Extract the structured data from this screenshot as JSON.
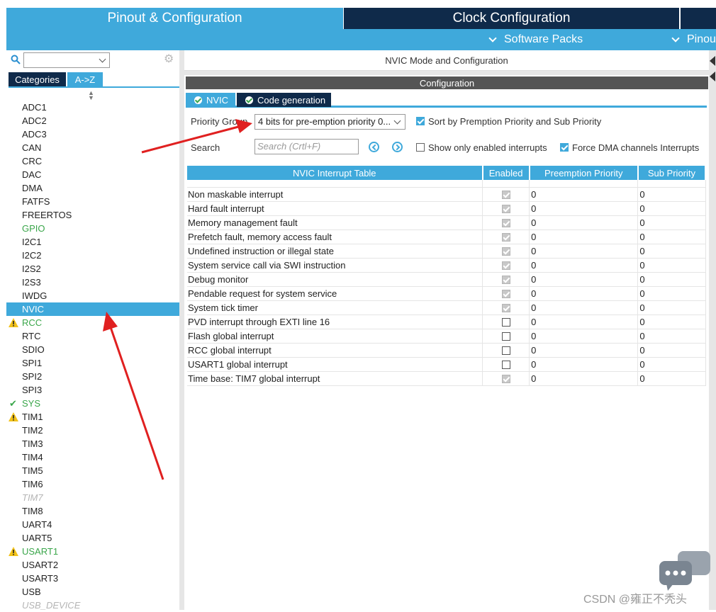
{
  "top_tabs": {
    "pinout": "Pinout & Configuration",
    "clock": "Clock Configuration"
  },
  "subbar": {
    "software_packs": "Software Packs",
    "pinout": "Pinout"
  },
  "left": {
    "tabs": {
      "categories": "Categories",
      "az": "A->Z"
    },
    "items": [
      {
        "label": "ADC1",
        "state": "normal"
      },
      {
        "label": "ADC2",
        "state": "normal"
      },
      {
        "label": "ADC3",
        "state": "normal"
      },
      {
        "label": "CAN",
        "state": "normal"
      },
      {
        "label": "CRC",
        "state": "normal"
      },
      {
        "label": "DAC",
        "state": "normal"
      },
      {
        "label": "DMA",
        "state": "normal"
      },
      {
        "label": "FATFS",
        "state": "normal"
      },
      {
        "label": "FREERTOS",
        "state": "normal"
      },
      {
        "label": "GPIO",
        "state": "green"
      },
      {
        "label": "I2C1",
        "state": "normal"
      },
      {
        "label": "I2C2",
        "state": "normal"
      },
      {
        "label": "I2S2",
        "state": "normal"
      },
      {
        "label": "I2S3",
        "state": "normal"
      },
      {
        "label": "IWDG",
        "state": "normal"
      },
      {
        "label": "NVIC",
        "state": "selected"
      },
      {
        "label": "RCC",
        "state": "green-warn"
      },
      {
        "label": "RTC",
        "state": "normal"
      },
      {
        "label": "SDIO",
        "state": "normal"
      },
      {
        "label": "SPI1",
        "state": "normal"
      },
      {
        "label": "SPI2",
        "state": "normal"
      },
      {
        "label": "SPI3",
        "state": "normal"
      },
      {
        "label": "SYS",
        "state": "green-ok"
      },
      {
        "label": "TIM1",
        "state": "warn"
      },
      {
        "label": "TIM2",
        "state": "normal"
      },
      {
        "label": "TIM3",
        "state": "normal"
      },
      {
        "label": "TIM4",
        "state": "normal"
      },
      {
        "label": "TIM5",
        "state": "normal"
      },
      {
        "label": "TIM6",
        "state": "normal"
      },
      {
        "label": "TIM7",
        "state": "disabled"
      },
      {
        "label": "TIM8",
        "state": "normal"
      },
      {
        "label": "UART4",
        "state": "normal"
      },
      {
        "label": "UART5",
        "state": "normal"
      },
      {
        "label": "USART1",
        "state": "green-warn"
      },
      {
        "label": "USART2",
        "state": "normal"
      },
      {
        "label": "USART3",
        "state": "normal"
      },
      {
        "label": "USB",
        "state": "normal"
      },
      {
        "label": "USB_DEVICE",
        "state": "disabled"
      }
    ]
  },
  "right": {
    "title": "NVIC Mode and Configuration",
    "config_bar": "Configuration",
    "tabs": {
      "nvic": "NVIC",
      "code": "Code generation"
    },
    "priority_group_label": "Priority Group",
    "priority_group_value": "4 bits for pre-emption priority 0...",
    "search_label": "Search",
    "search_placeholder": "Search (Crtl+F)",
    "sort_label": "Sort by Premption Priority and Sub Priority",
    "sort_checked": true,
    "show_enabled_label": "Show only enabled interrupts",
    "show_enabled_checked": false,
    "force_dma_label": "Force DMA channels Interrupts",
    "force_dma_checked": true,
    "table": {
      "headers": [
        "NVIC Interrupt Table",
        "Enabled",
        "Preemption Priority",
        "Sub Priority"
      ],
      "rows": [
        {
          "name": "Non maskable interrupt",
          "enabled": true,
          "locked": true,
          "pp": "0",
          "sp": "0",
          "dim": true
        },
        {
          "name": "Hard fault interrupt",
          "enabled": true,
          "locked": true,
          "pp": "0",
          "sp": "0",
          "dim": true
        },
        {
          "name": "Memory management fault",
          "enabled": true,
          "locked": true,
          "pp": "0",
          "sp": "0",
          "dim": false
        },
        {
          "name": "Prefetch fault, memory access fault",
          "enabled": true,
          "locked": true,
          "pp": "0",
          "sp": "0",
          "dim": false
        },
        {
          "name": "Undefined instruction or illegal state",
          "enabled": true,
          "locked": true,
          "pp": "0",
          "sp": "0",
          "dim": false
        },
        {
          "name": "System service call via SWI instruction",
          "enabled": true,
          "locked": true,
          "pp": "0",
          "sp": "0",
          "dim": false
        },
        {
          "name": "Debug monitor",
          "enabled": true,
          "locked": true,
          "pp": "0",
          "sp": "0",
          "dim": false
        },
        {
          "name": "Pendable request for system service",
          "enabled": true,
          "locked": true,
          "pp": "0",
          "sp": "0",
          "dim": false
        },
        {
          "name": "System tick timer",
          "enabled": true,
          "locked": true,
          "pp": "0",
          "sp": "0",
          "dim": false
        },
        {
          "name": "PVD interrupt through EXTI line 16",
          "enabled": false,
          "locked": false,
          "pp": "0",
          "sp": "0",
          "dim": false
        },
        {
          "name": "Flash global interrupt",
          "enabled": false,
          "locked": false,
          "pp": "0",
          "sp": "0",
          "dim": false
        },
        {
          "name": "RCC global interrupt",
          "enabled": false,
          "locked": false,
          "pp": "0",
          "sp": "0",
          "dim": false
        },
        {
          "name": "USART1 global interrupt",
          "enabled": false,
          "locked": false,
          "pp": "0",
          "sp": "0",
          "dim": false
        },
        {
          "name": "Time base: TIM7 global interrupt",
          "enabled": true,
          "locked": true,
          "pp": "0",
          "sp": "0",
          "dim": false
        }
      ]
    }
  },
  "watermark": "CSDN @雍正不秃头",
  "colors": {
    "accent": "#3fa9db",
    "dark": "#0f2a4a",
    "annotation": "#e02020",
    "green": "#3aa64a"
  }
}
